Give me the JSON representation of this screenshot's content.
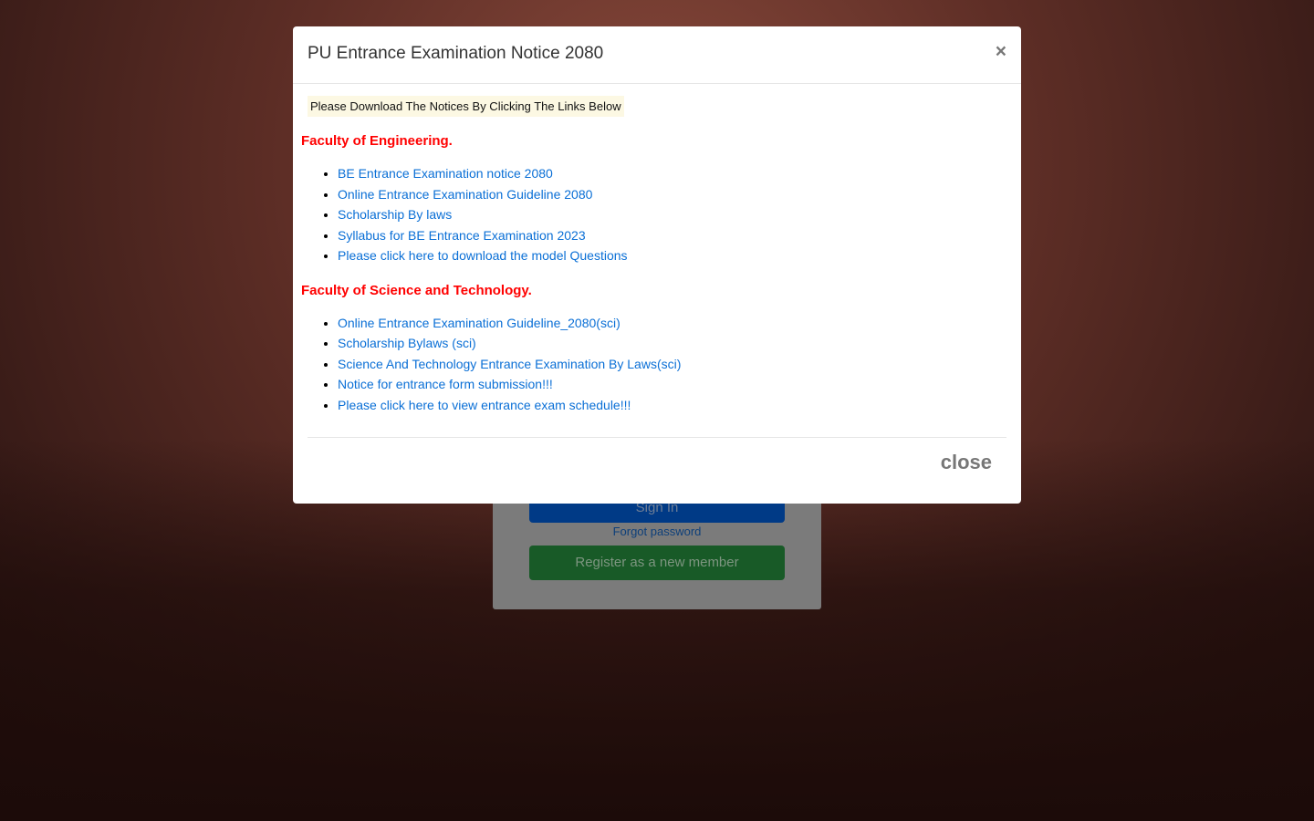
{
  "background": {
    "login": {
      "signin_label": "Sign In",
      "forgot_label": "Forgot password",
      "register_label": "Register as a new member"
    }
  },
  "modal": {
    "title": "PU Entrance Examination Notice 2080",
    "close_x": "×",
    "note": "Please Download The Notices By Clicking The Links Below",
    "sections": [
      {
        "heading": "Faculty of Engineering.",
        "links": [
          "BE Entrance Examination notice 2080",
          "Online Entrance Examination Guideline 2080",
          "Scholarship By laws",
          "Syllabus for BE Entrance Examination 2023",
          "Please click here to download the model Questions"
        ]
      },
      {
        "heading": "Faculty of Science and Technology.",
        "links": [
          "Online Entrance Examination Guideline_2080(sci)",
          "Scholarship Bylaws (sci)",
          "Science And Technology Entrance Examination By Laws(sci)",
          "Notice for entrance form submission!!!",
          "Please click here to view entrance exam schedule!!!"
        ]
      }
    ],
    "close_label": "close"
  }
}
